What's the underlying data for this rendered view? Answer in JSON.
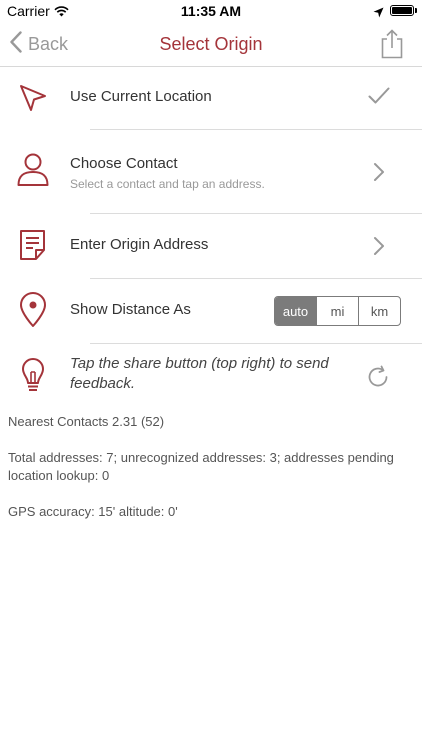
{
  "status_bar": {
    "carrier": "Carrier",
    "time": "11:35 AM"
  },
  "nav": {
    "back_label": "Back",
    "title": "Select Origin"
  },
  "rows": {
    "current_location": {
      "title": "Use Current Location"
    },
    "choose_contact": {
      "title": "Choose Contact",
      "subtitle": "Select a contact and tap an address."
    },
    "enter_address": {
      "title": "Enter Origin Address"
    },
    "show_distance": {
      "title": "Show Distance As",
      "options": [
        "auto",
        "mi",
        "km"
      ],
      "selected": "auto"
    },
    "tip": {
      "text": "Tap the share button (top right) to send feedback."
    }
  },
  "info": {
    "version": "Nearest Contacts 2.31 (52)",
    "addresses": "Total addresses: 7; unrecognized addresses: 3; addresses pending location lookup: 0",
    "gps": "GPS accuracy: 15' altitude: 0'"
  },
  "colors": {
    "accent": "#a4343a",
    "gray": "#999999"
  }
}
